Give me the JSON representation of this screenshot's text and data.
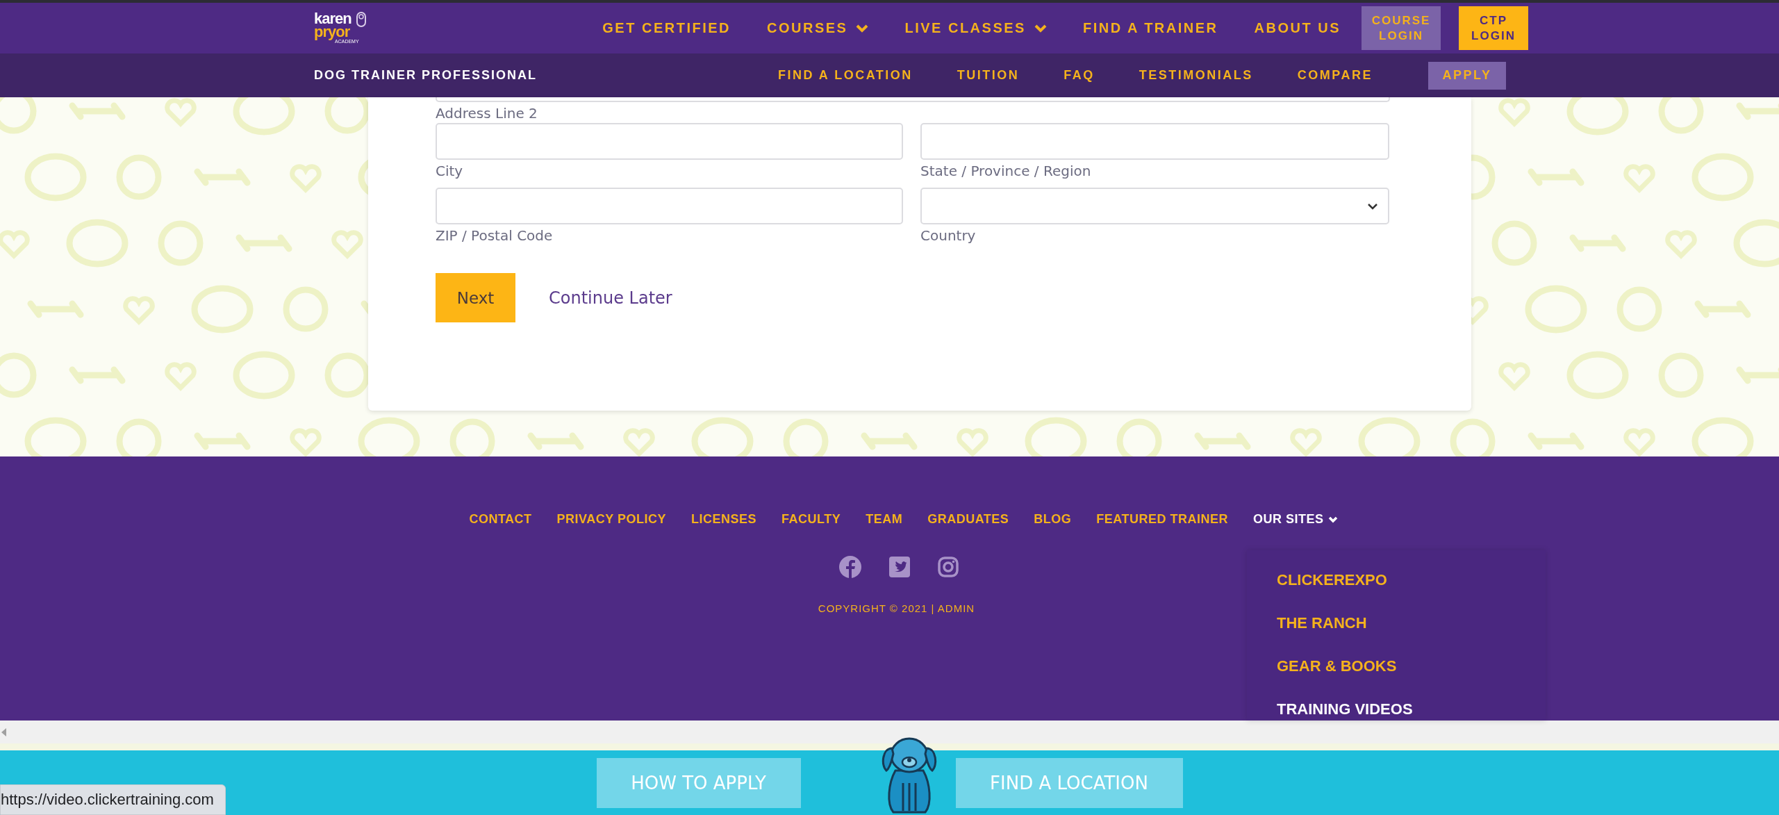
{
  "header": {
    "logo": {
      "line_1": "karen",
      "line_2": "pryor",
      "line_3": "ACADEMY"
    },
    "nav": [
      {
        "label": "GET CERTIFIED",
        "dropdown": false
      },
      {
        "label": "COURSES",
        "dropdown": true
      },
      {
        "label": "LIVE CLASSES",
        "dropdown": true
      },
      {
        "label": "FIND A TRAINER",
        "dropdown": false
      },
      {
        "label": "ABOUT US",
        "dropdown": false
      }
    ],
    "course_login": "COURSE LOGIN",
    "ctp_login": "CTP LOGIN"
  },
  "subnav": {
    "title": "DOG TRAINER PROFESSIONAL",
    "links": [
      "FIND A LOCATION",
      "TUITION",
      "FAQ",
      "TESTIMONIALS",
      "COMPARE"
    ],
    "apply": "APPLY"
  },
  "form": {
    "address_line_2": {
      "label": "Address Line 2"
    },
    "fields": [
      {
        "label": "City",
        "kind": "text"
      },
      {
        "label": "State / Province / Region",
        "kind": "text"
      },
      {
        "label": "ZIP / Postal Code",
        "kind": "text"
      },
      {
        "label": "Country",
        "kind": "select"
      }
    ],
    "next": "Next",
    "continue_later": "Continue Later"
  },
  "footer": {
    "links": [
      {
        "label": "CONTACT",
        "kind": "link"
      },
      {
        "label": "PRIVACY POLICY",
        "kind": "link"
      },
      {
        "label": "LICENSES",
        "kind": "link"
      },
      {
        "label": "FACULTY",
        "kind": "link"
      },
      {
        "label": "TEAM",
        "kind": "link"
      },
      {
        "label": "GRADUATES",
        "kind": "link"
      },
      {
        "label": "BLOG",
        "kind": "link"
      },
      {
        "label": "FEATURED TRAINER",
        "kind": "link"
      },
      {
        "label": "OUR SITES",
        "kind": "menu",
        "expanded": true
      }
    ],
    "copyright": "COPYRIGHT © 2021 | ADMIN",
    "our_sites": [
      {
        "label": "CLICKEREXPO",
        "highlighted": false
      },
      {
        "label": "THE RANCH",
        "highlighted": false
      },
      {
        "label": "GEAR & BOOKS",
        "highlighted": false
      },
      {
        "label": "TRAINING VIDEOS",
        "highlighted": true
      }
    ]
  },
  "bottom_bar": {
    "buttons": [
      "HOW TO APPLY",
      "FIND A LOCATION"
    ]
  },
  "status_bar": {
    "url": "https://video.clickertraining.com"
  }
}
